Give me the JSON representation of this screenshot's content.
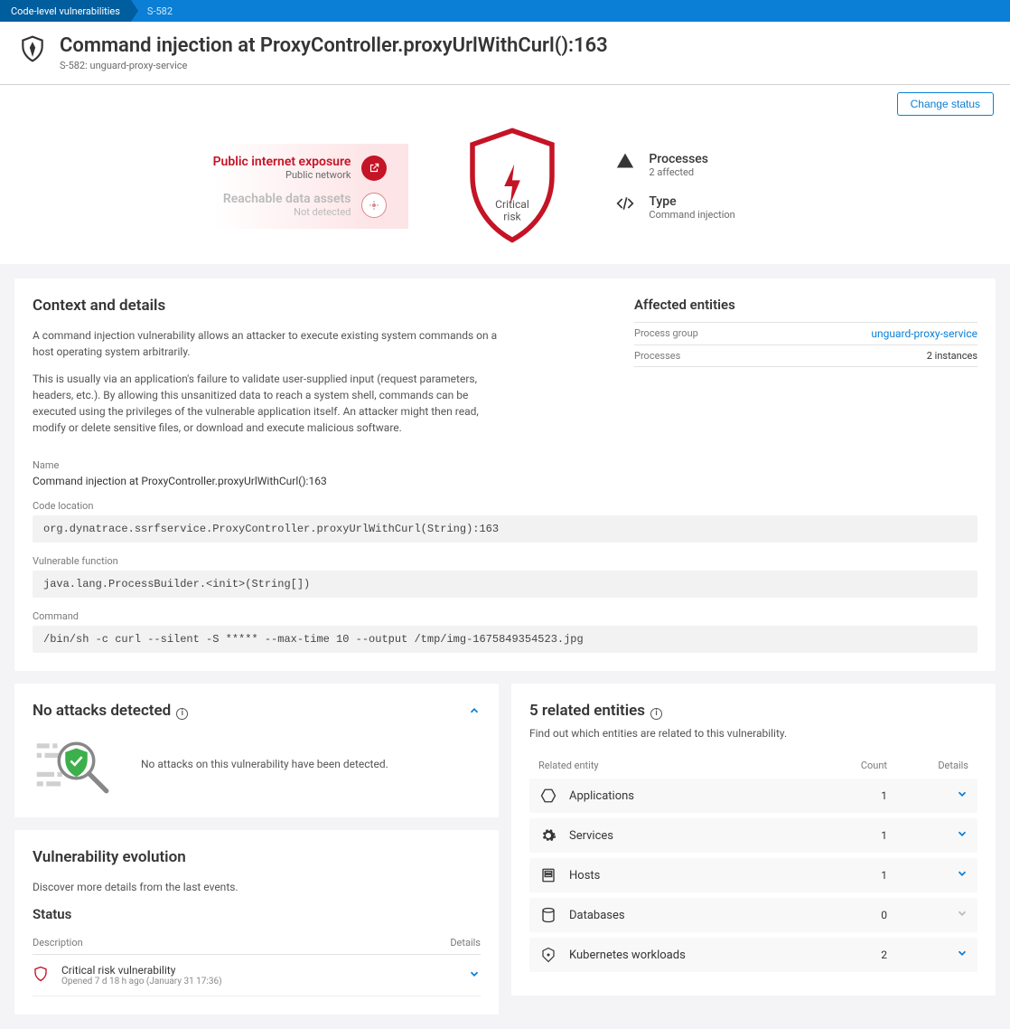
{
  "breadcrumb": {
    "first": "Code-level vulnerabilities",
    "second": "S-582"
  },
  "header": {
    "title": "Command injection at ProxyController.proxyUrlWithCurl():163",
    "subtitle": "S-582: unguard-proxy-service"
  },
  "actions": {
    "change_status": "Change status"
  },
  "exposure": {
    "internet": {
      "title": "Public internet exposure",
      "sub": "Public network"
    },
    "data": {
      "title": "Reachable data assets",
      "sub": "Not detected"
    }
  },
  "risk": {
    "label": "Critical risk"
  },
  "meta": {
    "processes": {
      "label": "Processes",
      "value": "2 affected"
    },
    "type": {
      "label": "Type",
      "value": "Command injection"
    }
  },
  "context": {
    "heading": "Context and details",
    "p1": "A command injection vulnerability allows an attacker to execute existing system commands on a host operating system arbitrarily.",
    "p2": "This is usually via an application's failure to validate user-supplied input (request parameters, headers, etc.). By allowing this unsanitized data to reach a system shell, commands can be executed using the privileges of the vulnerable application itself. An attacker might then read, modify or delete sensitive files, or download and execute malicious software.",
    "name_label": "Name",
    "name_value": "Command injection at ProxyController.proxyUrlWithCurl():163",
    "code_label": "Code location",
    "code_value": "org.dynatrace.ssrfservice.ProxyController.proxyUrlWithCurl(String):163",
    "func_label": "Vulnerable function",
    "func_value": "java.lang.ProcessBuilder.<init>(String[])",
    "cmd_label": "Command",
    "cmd_value": "/bin/sh -c curl --silent -S ***** --max-time 10 --output /tmp/img-1675849354523.jpg"
  },
  "affected": {
    "heading": "Affected entities",
    "rows": [
      {
        "label": "Process group",
        "value": "unguard-proxy-service",
        "link": true
      },
      {
        "label": "Processes",
        "value": "2 instances",
        "link": false
      }
    ]
  },
  "attacks": {
    "heading": "No attacks detected",
    "msg": "No attacks on this vulnerability have been detected."
  },
  "evolution": {
    "heading": "Vulnerability evolution",
    "intro": "Discover more details from the last events.",
    "status_label": "Status",
    "col_desc": "Description",
    "col_det": "Details",
    "rows": [
      {
        "title": "Critical risk vulnerability",
        "sub": "Opened 7 d 18 h ago (January 31 17:36)"
      }
    ]
  },
  "related": {
    "heading": "5 related entities",
    "intro": "Find out which entities are related to this vulnerability.",
    "col_name": "Related entity",
    "col_count": "Count",
    "col_det": "Details",
    "rows": [
      {
        "icon": "hexagon",
        "name": "Applications",
        "count": 1,
        "expandable": true
      },
      {
        "icon": "gear",
        "name": "Services",
        "count": 1,
        "expandable": true
      },
      {
        "icon": "host",
        "name": "Hosts",
        "count": 1,
        "expandable": true
      },
      {
        "icon": "db",
        "name": "Databases",
        "count": 0,
        "expandable": false
      },
      {
        "icon": "k8s",
        "name": "Kubernetes workloads",
        "count": 2,
        "expandable": true
      }
    ]
  }
}
